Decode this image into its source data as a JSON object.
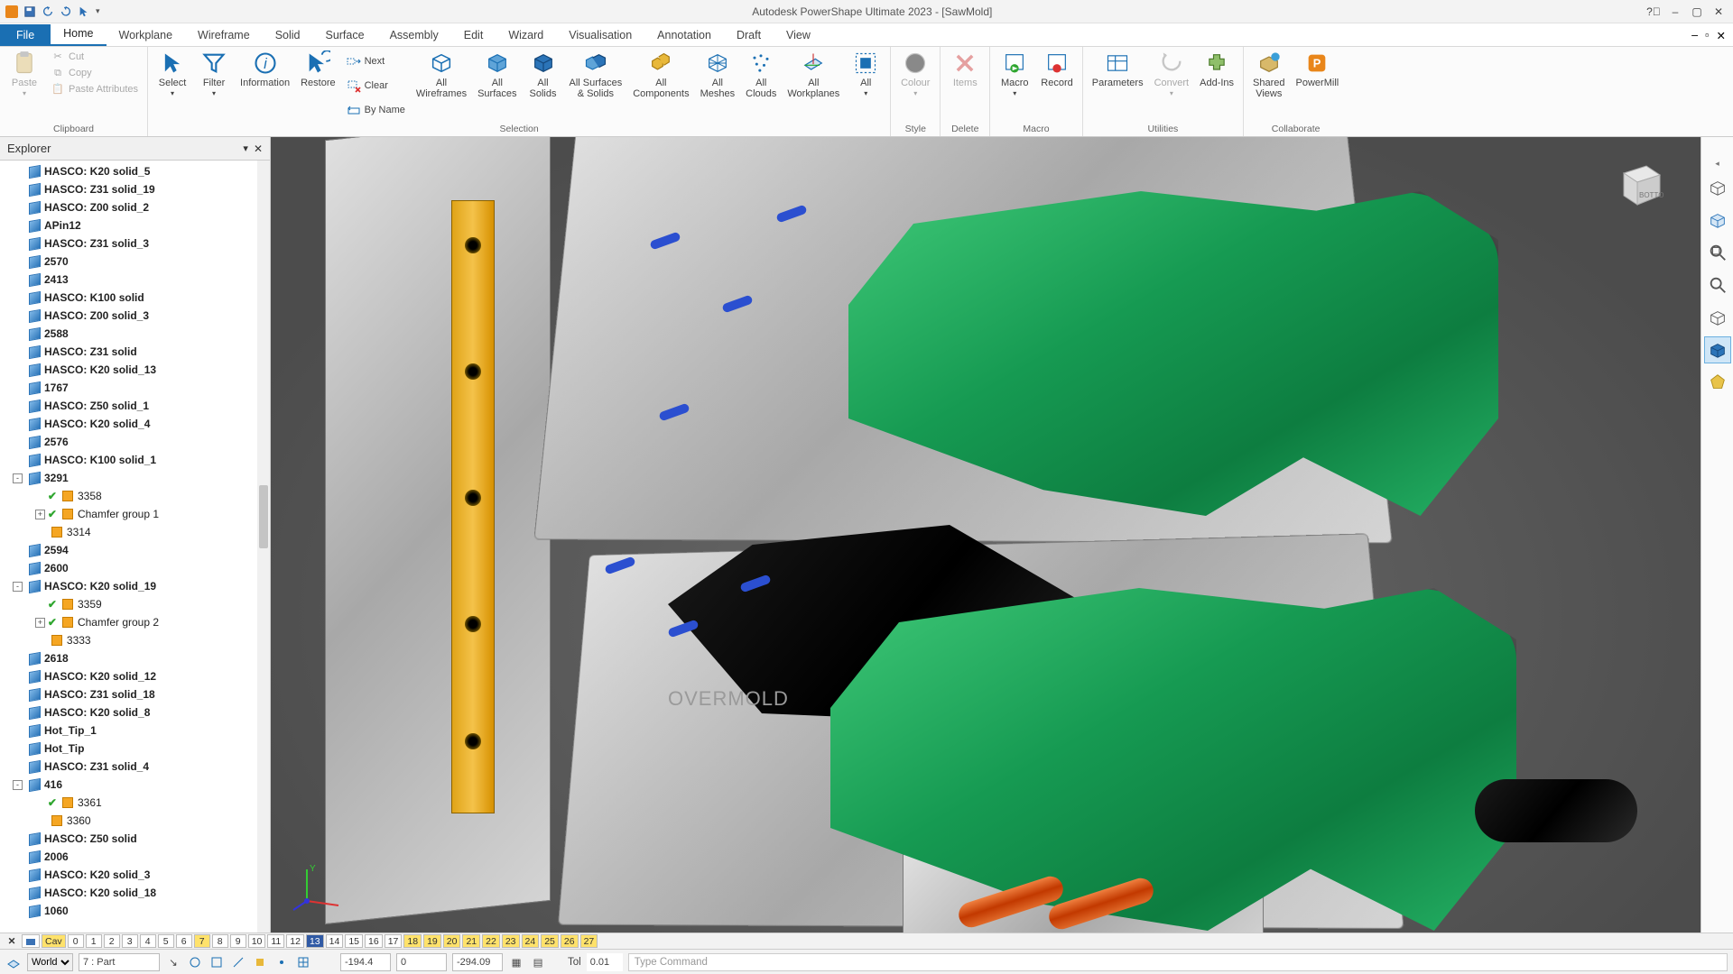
{
  "titlebar": {
    "title": "Autodesk PowerShape Ultimate 2023 - [SawMold]"
  },
  "tabs": {
    "file": "File",
    "items": [
      "Home",
      "Workplane",
      "Wireframe",
      "Solid",
      "Surface",
      "Assembly",
      "Edit",
      "Wizard",
      "Visualisation",
      "Annotation",
      "Draft",
      "View"
    ],
    "active": 0
  },
  "ribbon": {
    "clipboard": {
      "paste": "Paste",
      "cut": "Cut",
      "copy": "Copy",
      "pasteattrs": "Paste Attributes",
      "label": "Clipboard"
    },
    "selection": {
      "select": "Select",
      "filter": "Filter",
      "information": "Information",
      "restore": "Restore",
      "next": "Next",
      "clear": "Clear",
      "byname": "By Name",
      "allwf": "All\nWireframes",
      "allsf": "All\nSurfaces",
      "allso": "All\nSolids",
      "allss": "All Surfaces\n& Solids",
      "allcp": "All\nComponents",
      "allms": "All\nMeshes",
      "allcl": "All\nClouds",
      "allwp": "All\nWorkplanes",
      "all": "All",
      "label": "Selection"
    },
    "style": {
      "colour": "Colour",
      "label": "Style"
    },
    "delete": {
      "items": "Items",
      "label": "Delete"
    },
    "macro": {
      "macro": "Macro",
      "record": "Record",
      "label": "Macro"
    },
    "utilities": {
      "parameters": "Parameters",
      "convert": "Convert",
      "addins": "Add-Ins",
      "label": "Utilities"
    },
    "collaborate": {
      "shared": "Shared\nViews",
      "powermill": "PowerMill",
      "label": "Collaborate"
    }
  },
  "explorer": {
    "title": "Explorer",
    "items": [
      {
        "name": "HASCO: K20 solid_5",
        "depth": 1,
        "bold": true,
        "icon": "solid"
      },
      {
        "name": "HASCO: Z31 solid_19",
        "depth": 1,
        "bold": true,
        "icon": "solid"
      },
      {
        "name": "HASCO: Z00 solid_2",
        "depth": 1,
        "bold": true,
        "icon": "solid"
      },
      {
        "name": "APin12",
        "depth": 1,
        "bold": true,
        "icon": "solid"
      },
      {
        "name": "HASCO: Z31 solid_3",
        "depth": 1,
        "bold": true,
        "icon": "solid"
      },
      {
        "name": "2570",
        "depth": 1,
        "bold": true,
        "icon": "solid"
      },
      {
        "name": "2413",
        "depth": 1,
        "bold": true,
        "icon": "solid"
      },
      {
        "name": "HASCO: K100 solid",
        "depth": 1,
        "bold": true,
        "icon": "solid"
      },
      {
        "name": "HASCO: Z00 solid_3",
        "depth": 1,
        "bold": true,
        "icon": "solid"
      },
      {
        "name": "2588",
        "depth": 1,
        "bold": true,
        "icon": "solid"
      },
      {
        "name": "HASCO: Z31 solid",
        "depth": 1,
        "bold": true,
        "icon": "solid"
      },
      {
        "name": "HASCO: K20 solid_13",
        "depth": 1,
        "bold": true,
        "icon": "solid"
      },
      {
        "name": "1767",
        "depth": 1,
        "bold": true,
        "icon": "solid"
      },
      {
        "name": "HASCO: Z50 solid_1",
        "depth": 1,
        "bold": true,
        "icon": "solid"
      },
      {
        "name": "HASCO: K20 solid_4",
        "depth": 1,
        "bold": true,
        "icon": "solid"
      },
      {
        "name": "2576",
        "depth": 1,
        "bold": true,
        "icon": "solid"
      },
      {
        "name": "HASCO: K100 solid_1",
        "depth": 1,
        "bold": true,
        "icon": "solid"
      },
      {
        "name": "3291",
        "depth": 1,
        "bold": true,
        "icon": "solid",
        "exp": "-"
      },
      {
        "name": "3358",
        "depth": 2,
        "icon": "feat",
        "chk": true
      },
      {
        "name": "Chamfer group 1",
        "depth": 2,
        "icon": "feat",
        "chk": true,
        "exp": "+"
      },
      {
        "name": "3314",
        "depth": 2,
        "icon": "feat"
      },
      {
        "name": "2594",
        "depth": 1,
        "bold": true,
        "icon": "solid"
      },
      {
        "name": "2600",
        "depth": 1,
        "bold": true,
        "icon": "solid"
      },
      {
        "name": "HASCO: K20 solid_19",
        "depth": 1,
        "bold": true,
        "icon": "solid",
        "exp": "-"
      },
      {
        "name": "3359",
        "depth": 2,
        "icon": "feat",
        "chk": true
      },
      {
        "name": "Chamfer group 2",
        "depth": 2,
        "icon": "feat",
        "chk": true,
        "exp": "+"
      },
      {
        "name": "3333",
        "depth": 2,
        "icon": "feat"
      },
      {
        "name": "2618",
        "depth": 1,
        "bold": true,
        "icon": "solid"
      },
      {
        "name": "HASCO: K20 solid_12",
        "depth": 1,
        "bold": true,
        "icon": "solid"
      },
      {
        "name": "HASCO: Z31 solid_18",
        "depth": 1,
        "bold": true,
        "icon": "solid"
      },
      {
        "name": "HASCO: K20 solid_8",
        "depth": 1,
        "bold": true,
        "icon": "solid"
      },
      {
        "name": "Hot_Tip_1",
        "depth": 1,
        "bold": true,
        "icon": "solid"
      },
      {
        "name": "Hot_Tip",
        "depth": 1,
        "bold": true,
        "icon": "solid"
      },
      {
        "name": "HASCO: Z31 solid_4",
        "depth": 1,
        "bold": true,
        "icon": "solid"
      },
      {
        "name": "416",
        "depth": 1,
        "bold": true,
        "icon": "solid",
        "exp": "-"
      },
      {
        "name": "3361",
        "depth": 2,
        "icon": "feat",
        "chk": true
      },
      {
        "name": "3360",
        "depth": 2,
        "icon": "feat"
      },
      {
        "name": "HASCO: Z50 solid",
        "depth": 1,
        "bold": true,
        "icon": "solid"
      },
      {
        "name": "2006",
        "depth": 1,
        "bold": true,
        "icon": "solid"
      },
      {
        "name": "HASCO: K20 solid_3",
        "depth": 1,
        "bold": true,
        "icon": "solid"
      },
      {
        "name": "HASCO: K20 solid_18",
        "depth": 1,
        "bold": true,
        "icon": "solid"
      },
      {
        "name": "1060",
        "depth": 1,
        "bold": true,
        "icon": "solid"
      }
    ]
  },
  "layers": {
    "prefix": [
      "Cav"
    ],
    "nums": [
      "0",
      "1",
      "2",
      "3",
      "4",
      "5",
      "6",
      "7",
      "8",
      "9",
      "10",
      "11",
      "12",
      "13",
      "14",
      "15",
      "16",
      "17",
      "18",
      "19",
      "20",
      "21",
      "22",
      "23",
      "24",
      "25",
      "26",
      "27"
    ],
    "yellow": [
      7,
      18,
      19,
      20,
      21,
      22,
      23,
      24,
      25,
      26,
      27
    ],
    "active": 13
  },
  "status": {
    "world": "World",
    "level": "7  : Part",
    "x": "-194.4",
    "y": "0",
    "z": "-294.09",
    "tol_label": "Tol",
    "tol": "0.01",
    "cmd_ph": "Type Command"
  },
  "viewport": {
    "overmold": "OVERMOLD",
    "bottom": "BOTTOM"
  }
}
